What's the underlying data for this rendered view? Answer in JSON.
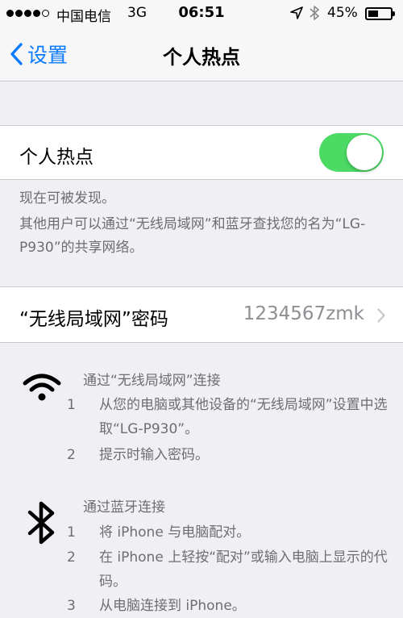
{
  "status_bar": {
    "carrier": "中国电信",
    "network": "3G",
    "time": "06:51",
    "battery_percent": "45%",
    "battery_level": 0.45,
    "signal_bars_filled": 4,
    "signal_bars_total": 5
  },
  "nav": {
    "back_label": "设置",
    "title": "个人热点"
  },
  "hotspot": {
    "label": "个人热点",
    "enabled": true,
    "toggle_color": "#4cd964",
    "discoverable_text": "现在可被发现。",
    "description": "其他用户可以通过“无线局域网”和蓝牙查找您的名为“LG-P930”的共享网络。"
  },
  "wifi_password": {
    "label": "“无线局域网”密码",
    "value": "1234567zmk"
  },
  "instructions": {
    "wifi": {
      "icon": "wifi-icon",
      "heading": "通过“无线局域网”连接",
      "steps": [
        {
          "num": "1",
          "text": "从您的电脑或其他设备的“无线局域网”设置中选取“LG-P930”。"
        },
        {
          "num": "2",
          "text": "提示时输入密码。"
        }
      ]
    },
    "bluetooth": {
      "icon": "bluetooth-icon",
      "heading": "通过蓝牙连接",
      "steps": [
        {
          "num": "1",
          "text": "将 iPhone 与电脑配对。"
        },
        {
          "num": "2",
          "text": "在 iPhone 上轻按“配对”或输入电脑上显示的代码。"
        },
        {
          "num": "3",
          "text": "从电脑连接到 iPhone。"
        }
      ]
    }
  },
  "colors": {
    "accent": "#0a7aff",
    "background": "#efeff4",
    "secondary_text": "#6d6d72"
  }
}
